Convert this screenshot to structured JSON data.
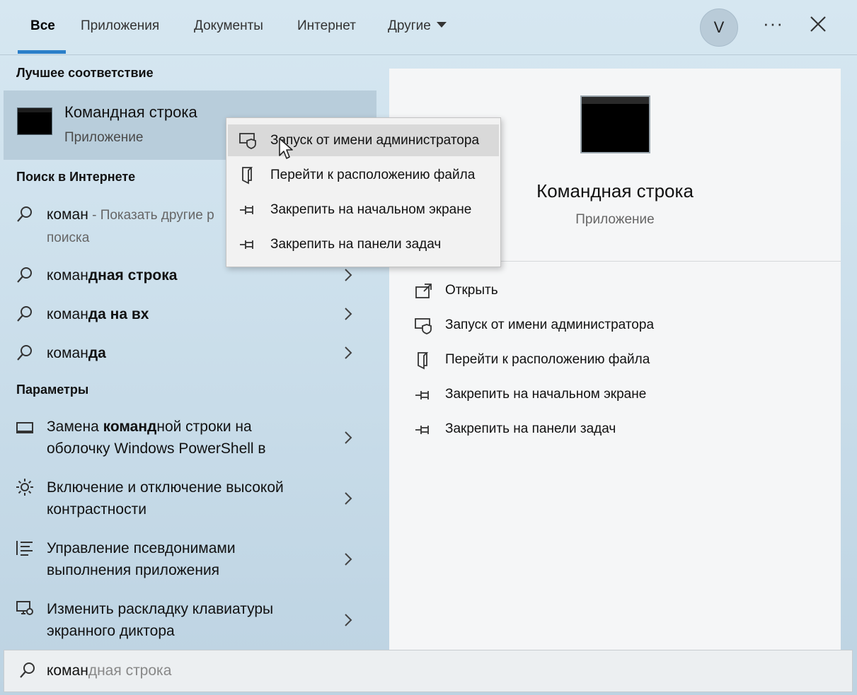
{
  "tabs": [
    {
      "label": "Все",
      "active": true
    },
    {
      "label": "Приложения"
    },
    {
      "label": "Документы"
    },
    {
      "label": "Интернет"
    },
    {
      "label": "Другие"
    }
  ],
  "account": {
    "initial": "V"
  },
  "header": {
    "more_label": "···"
  },
  "left": {
    "best_match_heading": "Лучшее соответствие",
    "best_match": {
      "title": "Командная строка",
      "subtitle": "Приложение",
      "icon": "command-prompt-icon"
    },
    "web_heading": "Поиск в Интернете",
    "web_items": [
      {
        "query": "коман",
        "suffix": " - Показать другие р",
        "line2": "поиска"
      },
      {
        "prefix": "коман",
        "bold": "дная строка"
      },
      {
        "prefix": "коман",
        "bold": "да на вх"
      },
      {
        "prefix": "коман",
        "bold": "да"
      }
    ],
    "settings_heading": "Параметры",
    "settings_items": [
      {
        "icon": "laptop-icon",
        "line1a": "Замена ",
        "line1b": "команд",
        "line1c": "ной строки на",
        "line2": "оболочку Windows PowerShell в"
      },
      {
        "icon": "brightness-icon",
        "line1a": "Включение и отключение высокой",
        "line1b": "",
        "line1c": "",
        "line2": "контрастности"
      },
      {
        "icon": "list-icon",
        "line1a": "Управление псевдонимами",
        "line1b": "",
        "line1c": "",
        "line2": "выполнения приложения"
      },
      {
        "icon": "narrator-icon",
        "line1a": "Изменить раскладку клавиатуры",
        "line1b": "",
        "line1c": "",
        "line2": "экранного диктора"
      }
    ]
  },
  "right": {
    "title": "Командная строка",
    "subtitle": "Приложение",
    "actions": [
      {
        "label": "Открыть",
        "icon": "open-icon"
      },
      {
        "label": "Запуск от имени администратора",
        "icon": "admin-shield-icon"
      },
      {
        "label": "Перейти к расположению файла",
        "icon": "file-location-icon"
      },
      {
        "label": "Закрепить на начальном экране",
        "icon": "pin-icon"
      },
      {
        "label": "Закрепить на панели задач",
        "icon": "pin-icon"
      }
    ]
  },
  "context_menu": {
    "items": [
      {
        "label": "Запуск от имени администратора",
        "icon": "admin-shield-icon",
        "hover": true
      },
      {
        "label": "Перейти к расположению файла",
        "icon": "file-location-icon"
      },
      {
        "label": "Закрепить на начальном экране",
        "icon": "pin-icon"
      },
      {
        "label": "Закрепить на панели задач",
        "icon": "pin-icon"
      }
    ]
  },
  "search": {
    "typed": "коман",
    "suggestion": "дная строка"
  }
}
